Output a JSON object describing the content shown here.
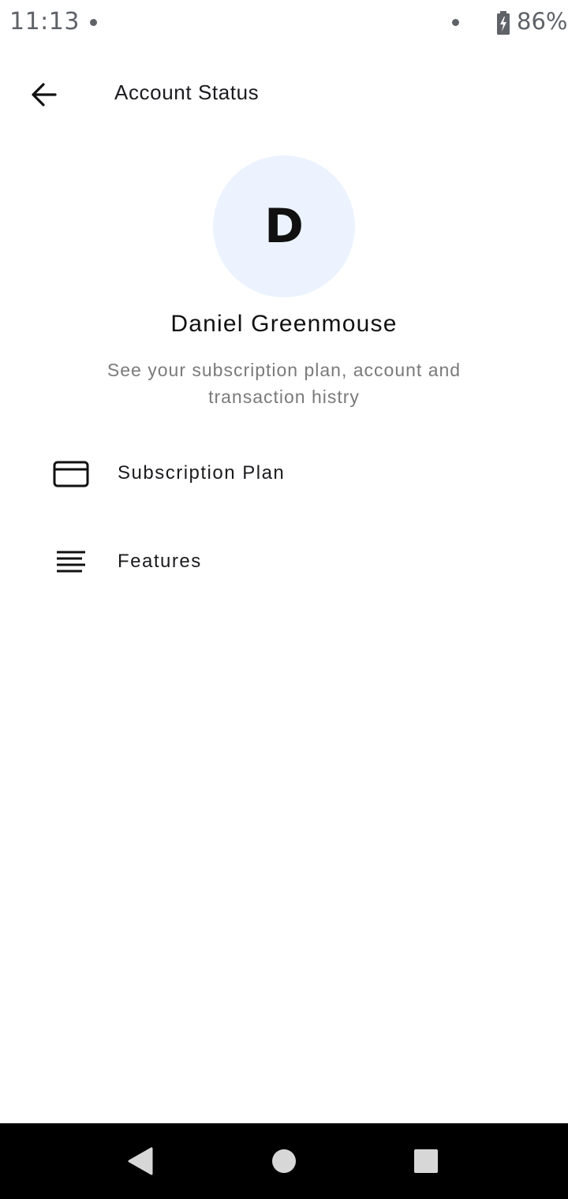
{
  "status_bar": {
    "time": "11:13",
    "battery": "86%"
  },
  "app_bar": {
    "title": "Account Status",
    "back_icon": "arrow-left-icon"
  },
  "profile": {
    "initial": "D",
    "name": "Daniel Greenmouse",
    "description": "See your subscription plan, account and transaction histry"
  },
  "menu": {
    "items": [
      {
        "label": "Subscription Plan",
        "icon": "credit-card-icon"
      },
      {
        "label": "Features",
        "icon": "list-lines-icon"
      }
    ]
  },
  "nav_bar": {
    "buttons": [
      "back-triangle-icon",
      "home-circle-icon",
      "recents-square-icon"
    ]
  },
  "colors": {
    "avatar_bg": "#ecf3fe",
    "text_primary": "#111111",
    "text_secondary": "#7a7a7a",
    "status_gray": "#5f6368"
  }
}
